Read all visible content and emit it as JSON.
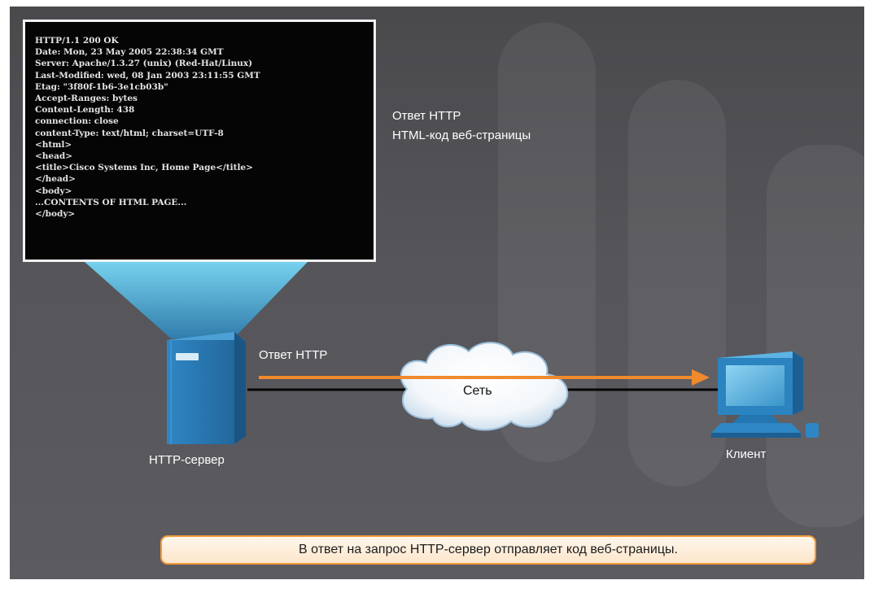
{
  "code_panel": {
    "lines": [
      "HTTP/1.1 200 OK",
      "Date: Mon, 23 May 2005 22:38:34 GMT",
      "Server: Apache/1.3.27 (unix) (Red-Hat/Linux)",
      "Last-Modified: wed, 08 Jan 2003 23:11:55 GMT",
      "Etag: \"3f80f-1b6-3e1cb03b\"",
      "Accept-Ranges: bytes",
      "Content-Length: 438",
      "connection: close",
      "content-Type: text/html; charset=UTF-8",
      "<html>",
      "<head>",
      "<title>Cisco Systems Inc, Home Page</title>",
      "</head>",
      "<body>",
      "...CONTENTS OF HTML PAGE...",
      "</body>"
    ]
  },
  "panel_description": {
    "line1": "Ответ HTTP",
    "line2": "HTML-код веб-страницы"
  },
  "arrow_label": "Ответ HTTP",
  "cloud_label": "Сеть",
  "server_label": "HTTP-сервер",
  "client_label": "Клиент",
  "caption": "В ответ на запрос HTTP-сервер отправляет код веб-страницы.",
  "colors": {
    "arrow": "#f08a2c",
    "server_body": "#2b7cb8",
    "beam": "#72d4f2",
    "caption_border": "#f39a3a"
  }
}
